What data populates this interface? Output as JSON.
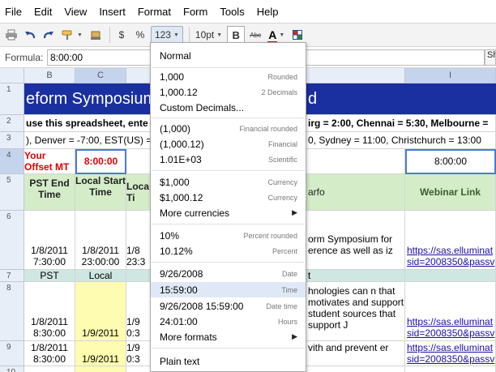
{
  "menubar": {
    "items": [
      "File",
      "Edit",
      "View",
      "Insert",
      "Format",
      "Form",
      "Tools",
      "Help"
    ]
  },
  "toolbar": {
    "currency": "$",
    "percent": "%",
    "number_format": "123",
    "font_size": "10pt",
    "bold": "B",
    "strike": "Abc",
    "text_color": "A"
  },
  "formula": {
    "label": "Formula:",
    "value": "8:00:00",
    "right_button": "Sh"
  },
  "grid": {
    "columns": [
      "B",
      "C",
      "",
      "",
      "I"
    ],
    "rows": [
      "1",
      "2",
      "3",
      "4",
      "5",
      "6",
      "7",
      "8",
      "9",
      "10"
    ],
    "r1_left": "eform Symposium",
    "r1_right": "d",
    "r2_left": "use this spreadsheet, ente",
    "r2_right": "irg = 2:00, Chennai = 5:30, Melbourne =",
    "r3_left": "), Denver = -7:00, EST(US) =",
    "r3_right": "0, Sydney = 11:00, Christchurch = 13:00",
    "r4_b": "Your Offset MT here =>",
    "r4_c": "8:00:00",
    "r4_i": "8:00:00",
    "r5_b": "PST End Time",
    "r5_c": "Local Start Time",
    "r5_d": "Loca Ti",
    "r5_f": "arfo",
    "r5_i": "Webinar Link",
    "r6_b": "1/8/2011 7:30:00",
    "r6_c": "1/8/2011 23:00:00",
    "r6_d": "1/8 23:3",
    "r6_f": "orm Symposium for erence as well as iz",
    "r6_i": "https://sas.elluminat sid=2008350&passv",
    "r7_b": "PST",
    "r7_c": "Local",
    "r7_f": "t",
    "r8_b": "1/8/2011 8:30:00",
    "r8_c": "1/9/2011",
    "r8_d": "1/9 0:3",
    "r8_f": "hnologies can n that motivates and support student sources that support J",
    "r8_i": "https://sas.elluminat sid=2008350&passv",
    "r9_b": "1/8/2011 8:30:00",
    "r9_c": "1/9/2011",
    "r9_d": "1/9 0:3",
    "r9_f": "vith and prevent er",
    "r9_i": "https://sas.elluminat sid=2008350&passv"
  },
  "number_menu": {
    "items": [
      {
        "label": "Normal",
        "hint": ""
      },
      {
        "label": "1,000",
        "hint": "Rounded"
      },
      {
        "label": "1,000.12",
        "hint": "2 Decimals"
      },
      {
        "label": "Custom Decimals...",
        "hint": ""
      },
      {
        "label": "(1,000)",
        "hint": "Financial rounded"
      },
      {
        "label": "(1,000.12)",
        "hint": "Financial"
      },
      {
        "label": "1.01E+03",
        "hint": "Scientific"
      },
      {
        "label": "$1,000",
        "hint": "Currency"
      },
      {
        "label": "$1,000.12",
        "hint": "Currency"
      },
      {
        "label": "More currencies",
        "hint": "▶"
      },
      {
        "label": "10%",
        "hint": "Percent rounded"
      },
      {
        "label": "10.12%",
        "hint": "Percent"
      },
      {
        "label": "9/26/2008",
        "hint": "Date"
      },
      {
        "label": "15:59:00",
        "hint": "Time"
      },
      {
        "label": "9/26/2008 15:59:00",
        "hint": "Date time"
      },
      {
        "label": "24:01:00",
        "hint": "Hours"
      },
      {
        "label": "More formats",
        "hint": "▶"
      },
      {
        "label": "Plain text",
        "hint": ""
      }
    ]
  },
  "colors": {
    "banner": "#1a2fa0",
    "header_green": "#d4ecc8",
    "row_teal": "#cfe7e2",
    "local_yellow": "#fdfcb0",
    "offset_red": "#e00000",
    "menu_highlight": "#dfe8f6"
  }
}
